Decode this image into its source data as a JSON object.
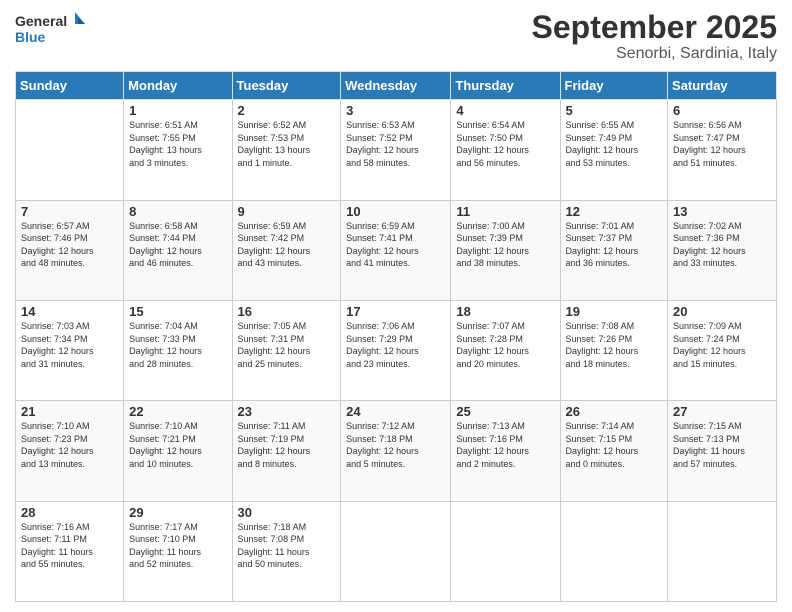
{
  "header": {
    "logo": {
      "general": "General",
      "blue": "Blue"
    },
    "title": "September 2025",
    "location": "Senorbi, Sardinia, Italy"
  },
  "calendar": {
    "days": [
      "Sunday",
      "Monday",
      "Tuesday",
      "Wednesday",
      "Thursday",
      "Friday",
      "Saturday"
    ],
    "weeks": [
      [
        {
          "day": "",
          "info": ""
        },
        {
          "day": "1",
          "info": "Sunrise: 6:51 AM\nSunset: 7:55 PM\nDaylight: 13 hours\nand 3 minutes."
        },
        {
          "day": "2",
          "info": "Sunrise: 6:52 AM\nSunset: 7:53 PM\nDaylight: 13 hours\nand 1 minute."
        },
        {
          "day": "3",
          "info": "Sunrise: 6:53 AM\nSunset: 7:52 PM\nDaylight: 12 hours\nand 58 minutes."
        },
        {
          "day": "4",
          "info": "Sunrise: 6:54 AM\nSunset: 7:50 PM\nDaylight: 12 hours\nand 56 minutes."
        },
        {
          "day": "5",
          "info": "Sunrise: 6:55 AM\nSunset: 7:49 PM\nDaylight: 12 hours\nand 53 minutes."
        },
        {
          "day": "6",
          "info": "Sunrise: 6:56 AM\nSunset: 7:47 PM\nDaylight: 12 hours\nand 51 minutes."
        }
      ],
      [
        {
          "day": "7",
          "info": "Sunrise: 6:57 AM\nSunset: 7:46 PM\nDaylight: 12 hours\nand 48 minutes."
        },
        {
          "day": "8",
          "info": "Sunrise: 6:58 AM\nSunset: 7:44 PM\nDaylight: 12 hours\nand 46 minutes."
        },
        {
          "day": "9",
          "info": "Sunrise: 6:59 AM\nSunset: 7:42 PM\nDaylight: 12 hours\nand 43 minutes."
        },
        {
          "day": "10",
          "info": "Sunrise: 6:59 AM\nSunset: 7:41 PM\nDaylight: 12 hours\nand 41 minutes."
        },
        {
          "day": "11",
          "info": "Sunrise: 7:00 AM\nSunset: 7:39 PM\nDaylight: 12 hours\nand 38 minutes."
        },
        {
          "day": "12",
          "info": "Sunrise: 7:01 AM\nSunset: 7:37 PM\nDaylight: 12 hours\nand 36 minutes."
        },
        {
          "day": "13",
          "info": "Sunrise: 7:02 AM\nSunset: 7:36 PM\nDaylight: 12 hours\nand 33 minutes."
        }
      ],
      [
        {
          "day": "14",
          "info": "Sunrise: 7:03 AM\nSunset: 7:34 PM\nDaylight: 12 hours\nand 31 minutes."
        },
        {
          "day": "15",
          "info": "Sunrise: 7:04 AM\nSunset: 7:33 PM\nDaylight: 12 hours\nand 28 minutes."
        },
        {
          "day": "16",
          "info": "Sunrise: 7:05 AM\nSunset: 7:31 PM\nDaylight: 12 hours\nand 25 minutes."
        },
        {
          "day": "17",
          "info": "Sunrise: 7:06 AM\nSunset: 7:29 PM\nDaylight: 12 hours\nand 23 minutes."
        },
        {
          "day": "18",
          "info": "Sunrise: 7:07 AM\nSunset: 7:28 PM\nDaylight: 12 hours\nand 20 minutes."
        },
        {
          "day": "19",
          "info": "Sunrise: 7:08 AM\nSunset: 7:26 PM\nDaylight: 12 hours\nand 18 minutes."
        },
        {
          "day": "20",
          "info": "Sunrise: 7:09 AM\nSunset: 7:24 PM\nDaylight: 12 hours\nand 15 minutes."
        }
      ],
      [
        {
          "day": "21",
          "info": "Sunrise: 7:10 AM\nSunset: 7:23 PM\nDaylight: 12 hours\nand 13 minutes."
        },
        {
          "day": "22",
          "info": "Sunrise: 7:10 AM\nSunset: 7:21 PM\nDaylight: 12 hours\nand 10 minutes."
        },
        {
          "day": "23",
          "info": "Sunrise: 7:11 AM\nSunset: 7:19 PM\nDaylight: 12 hours\nand 8 minutes."
        },
        {
          "day": "24",
          "info": "Sunrise: 7:12 AM\nSunset: 7:18 PM\nDaylight: 12 hours\nand 5 minutes."
        },
        {
          "day": "25",
          "info": "Sunrise: 7:13 AM\nSunset: 7:16 PM\nDaylight: 12 hours\nand 2 minutes."
        },
        {
          "day": "26",
          "info": "Sunrise: 7:14 AM\nSunset: 7:15 PM\nDaylight: 12 hours\nand 0 minutes."
        },
        {
          "day": "27",
          "info": "Sunrise: 7:15 AM\nSunset: 7:13 PM\nDaylight: 11 hours\nand 57 minutes."
        }
      ],
      [
        {
          "day": "28",
          "info": "Sunrise: 7:16 AM\nSunset: 7:11 PM\nDaylight: 11 hours\nand 55 minutes."
        },
        {
          "day": "29",
          "info": "Sunrise: 7:17 AM\nSunset: 7:10 PM\nDaylight: 11 hours\nand 52 minutes."
        },
        {
          "day": "30",
          "info": "Sunrise: 7:18 AM\nSunset: 7:08 PM\nDaylight: 11 hours\nand 50 minutes."
        },
        {
          "day": "",
          "info": ""
        },
        {
          "day": "",
          "info": ""
        },
        {
          "day": "",
          "info": ""
        },
        {
          "day": "",
          "info": ""
        }
      ]
    ]
  }
}
